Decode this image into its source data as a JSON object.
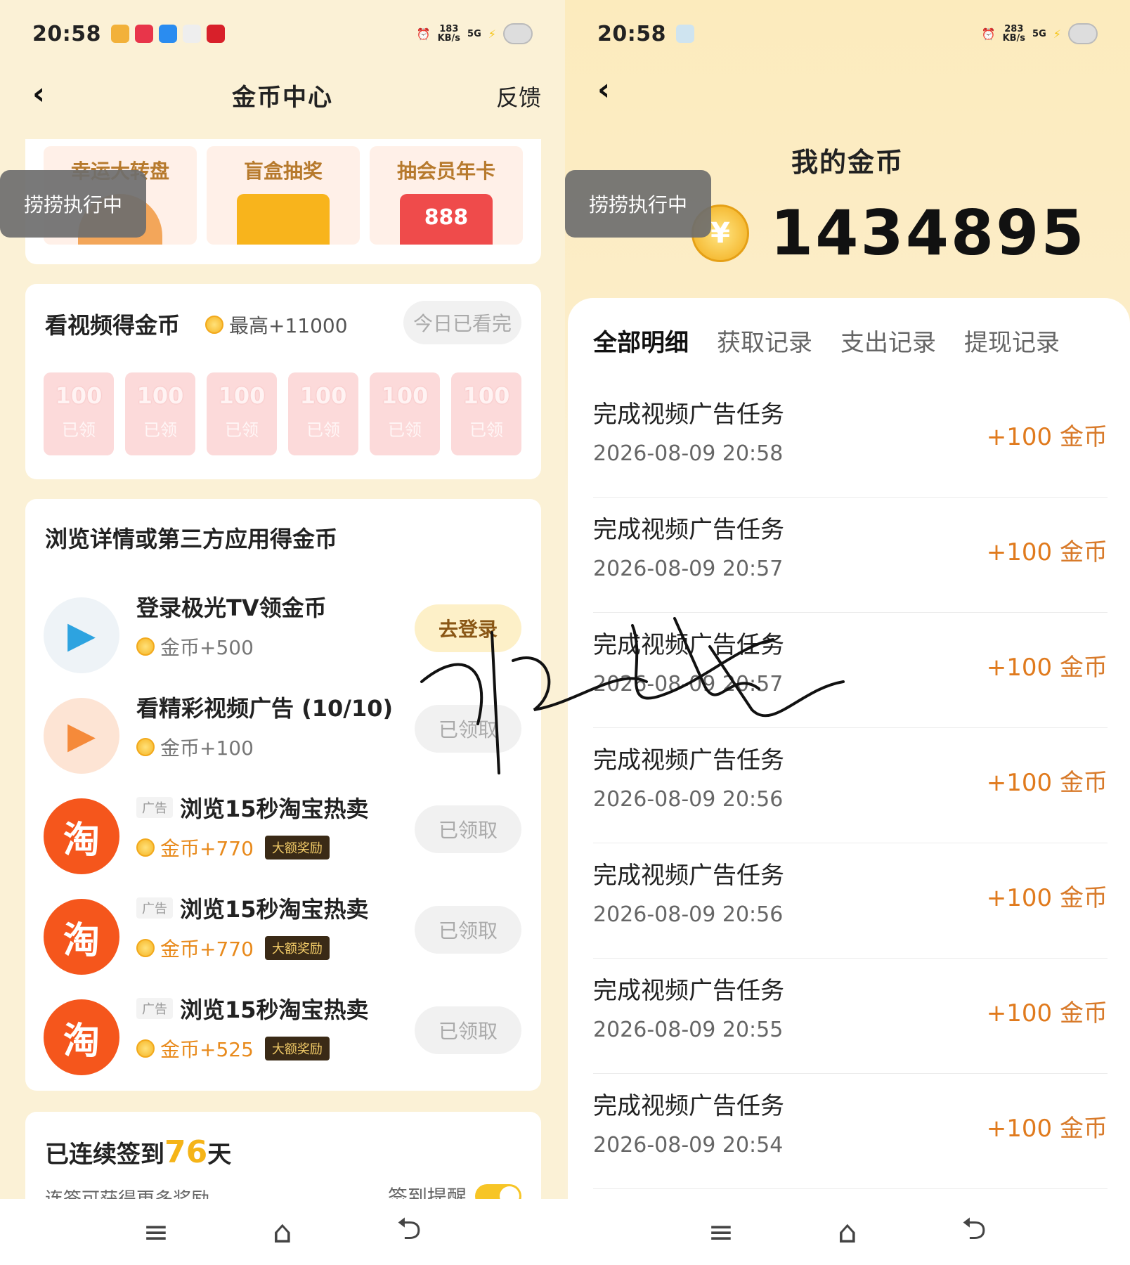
{
  "left": {
    "status": {
      "time": "20:58",
      "speed_value": "183",
      "speed_unit": "KB/s",
      "net": "5G"
    },
    "header": {
      "title": "金币中心",
      "feedback": "反馈"
    },
    "lottery": [
      {
        "label": "幸运大转盘",
        "color": "#f0a24a"
      },
      {
        "label": "盲盒抽奖",
        "color": "#f8b41c"
      },
      {
        "label": "抽会员年卡",
        "color": "#ef4b4b",
        "digits": "888"
      }
    ],
    "toast": "捞捞执行中",
    "video": {
      "title": "看视频得金币",
      "max_note": "最高+11000",
      "done": "今日已看完",
      "envelopes": [
        {
          "amount": "100",
          "label": "已领"
        },
        {
          "amount": "100",
          "label": "已领"
        },
        {
          "amount": "100",
          "label": "已领"
        },
        {
          "amount": "100",
          "label": "已领"
        },
        {
          "amount": "100",
          "label": "已领"
        },
        {
          "amount": "100",
          "label": "已领"
        }
      ]
    },
    "browse": {
      "title": "浏览详情或第三方应用得金币",
      "tasks": [
        {
          "name": "登录极光TV领金币",
          "reward": "金币+500",
          "button": "去登录",
          "ad": "",
          "big": ""
        },
        {
          "name": "看精彩视频广告 (10/10)",
          "reward": "金币+100",
          "button": "已领取",
          "ad": "",
          "big": ""
        },
        {
          "name": "浏览15秒淘宝热卖",
          "reward": "金币+770",
          "button": "已领取",
          "ad": "广告",
          "big": "大额奖励",
          "icon": "淘"
        },
        {
          "name": "浏览15秒淘宝热卖",
          "reward": "金币+770",
          "button": "已领取",
          "ad": "广告",
          "big": "大额奖励",
          "icon": "淘"
        },
        {
          "name": "浏览15秒淘宝热卖",
          "reward": "金币+525",
          "button": "已领取",
          "ad": "广告",
          "big": "大额奖励",
          "icon": "淘"
        }
      ]
    },
    "sign": {
      "prefix": "已连续签到",
      "days": "76",
      "suffix": "天",
      "sub": "连签可获得更多奖励",
      "remind": "签到提醒"
    }
  },
  "right": {
    "status": {
      "time": "20:58",
      "speed_value": "283",
      "speed_unit": "KB/s",
      "net": "5G"
    },
    "title": "我的金币",
    "balance": "1434895",
    "coin_glyph": "¥",
    "toast": "捞捞执行中",
    "tabs": [
      "全部明细",
      "获取记录",
      "支出记录",
      "提现记录"
    ],
    "records": [
      {
        "title": "完成视频广告任务",
        "date": "2026-08-09 20:58",
        "amount": "+100",
        "unit": "金币"
      },
      {
        "title": "完成视频广告任务",
        "date": "2026-08-09 20:57",
        "amount": "+100",
        "unit": "金币"
      },
      {
        "title": "完成视频广告任务",
        "date": "2026-08-09 20:57",
        "amount": "+100",
        "unit": "金币"
      },
      {
        "title": "完成视频广告任务",
        "date": "2026-08-09 20:56",
        "amount": "+100",
        "unit": "金币"
      },
      {
        "title": "完成视频广告任务",
        "date": "2026-08-09 20:56",
        "amount": "+100",
        "unit": "金币"
      },
      {
        "title": "完成视频广告任务",
        "date": "2026-08-09 20:55",
        "amount": "+100",
        "unit": "金币"
      },
      {
        "title": "完成视频广告任务",
        "date": "2026-08-09 20:54",
        "amount": "+100",
        "unit": "金币"
      }
    ]
  },
  "navbar": {
    "menu_icon": "≡",
    "home_icon": "⌂",
    "back_icon": "⮌"
  }
}
